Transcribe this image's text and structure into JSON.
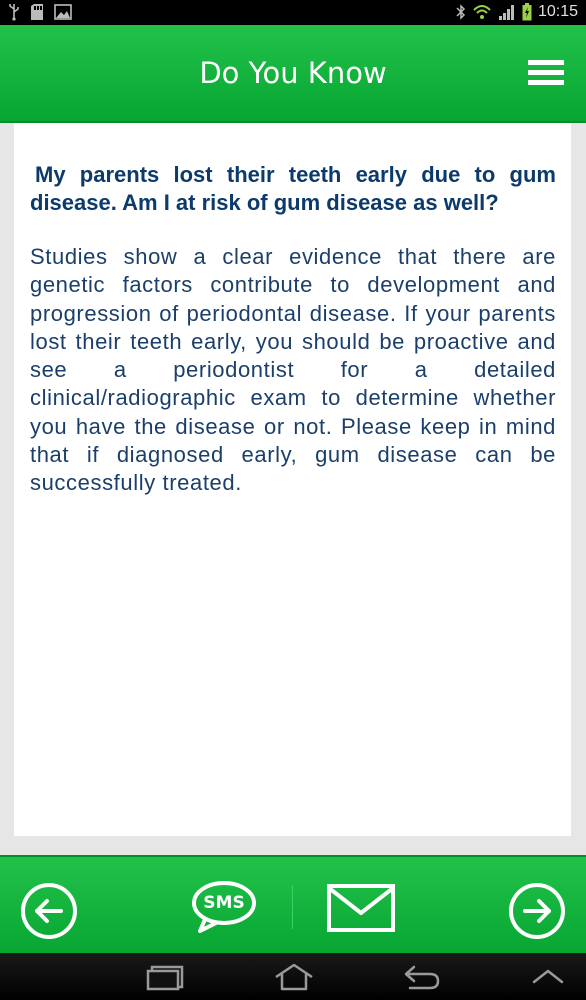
{
  "status_bar": {
    "time": "10:15",
    "icons_left": [
      "usb-icon",
      "sd-card-icon",
      "image-icon"
    ],
    "icons_right": [
      "bluetooth-icon",
      "wifi-icon",
      "signal-icon",
      "battery-icon"
    ]
  },
  "header": {
    "title": "Do You Know",
    "menu_icon": "hamburger-menu-icon"
  },
  "article": {
    "question": "My parents lost their teeth early due to gum disease. Am I at risk of gum disease as well?",
    "answer": "Studies show a clear evidence that there are genetic factors contribute to development and progression of periodontal disease. If your parents lost their teeth early, you should be proactive and see a periodontist for a detailed clinical/radiographic exam to determine whether you have the disease or not. Please keep in mind that if diagnosed early, gum disease can be successfully treated."
  },
  "actions": {
    "prev_icon": "arrow-left-circle-icon",
    "sms_label": "SMS",
    "mail_icon": "envelope-icon",
    "next_icon": "arrow-right-circle-icon"
  },
  "nav_bar": {
    "icons": [
      "recent-apps-icon",
      "home-icon",
      "back-icon",
      "chevron-up-icon"
    ]
  },
  "colors": {
    "brand_green": "#0cb13a",
    "question_text": "#0c3a6b",
    "answer_text": "#1b3f6a",
    "background": "#e6e6e6"
  }
}
